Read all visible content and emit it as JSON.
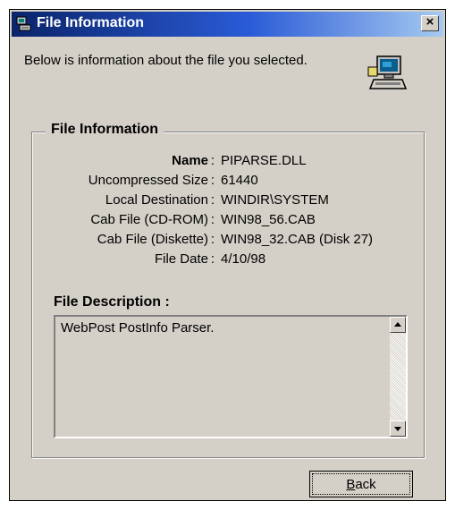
{
  "window": {
    "title": "File Information",
    "close_label": "×"
  },
  "intro": {
    "text": "Below is information about the file you selected."
  },
  "group": {
    "title": "File Information",
    "rows": [
      {
        "label": "Name",
        "value": "PIPARSE.DLL"
      },
      {
        "label": "Uncompressed Size",
        "value": "61440"
      },
      {
        "label": "Local Destination",
        "value": "WINDIR\\SYSTEM"
      },
      {
        "label": "Cab File (CD-ROM)",
        "value": "WIN98_56.CAB"
      },
      {
        "label": "Cab File (Diskette)",
        "value": "WIN98_32.CAB (Disk 27)"
      },
      {
        "label": "File Date",
        "value": "4/10/98"
      }
    ],
    "separator": ":"
  },
  "description": {
    "title": "File Description :",
    "text": "WebPost PostInfo Parser."
  },
  "buttons": {
    "back_first_letter": "B",
    "back_rest": "ack"
  },
  "icons": {
    "app": "computer-setup-icon",
    "computer": "computer-monitor-icon",
    "scroll_up": "scroll-up-arrow-icon",
    "scroll_down": "scroll-down-arrow-icon"
  },
  "colors": {
    "titlebar_start": "#0a246a",
    "titlebar_end": "#a6caf0",
    "face": "#d4d0c8"
  }
}
